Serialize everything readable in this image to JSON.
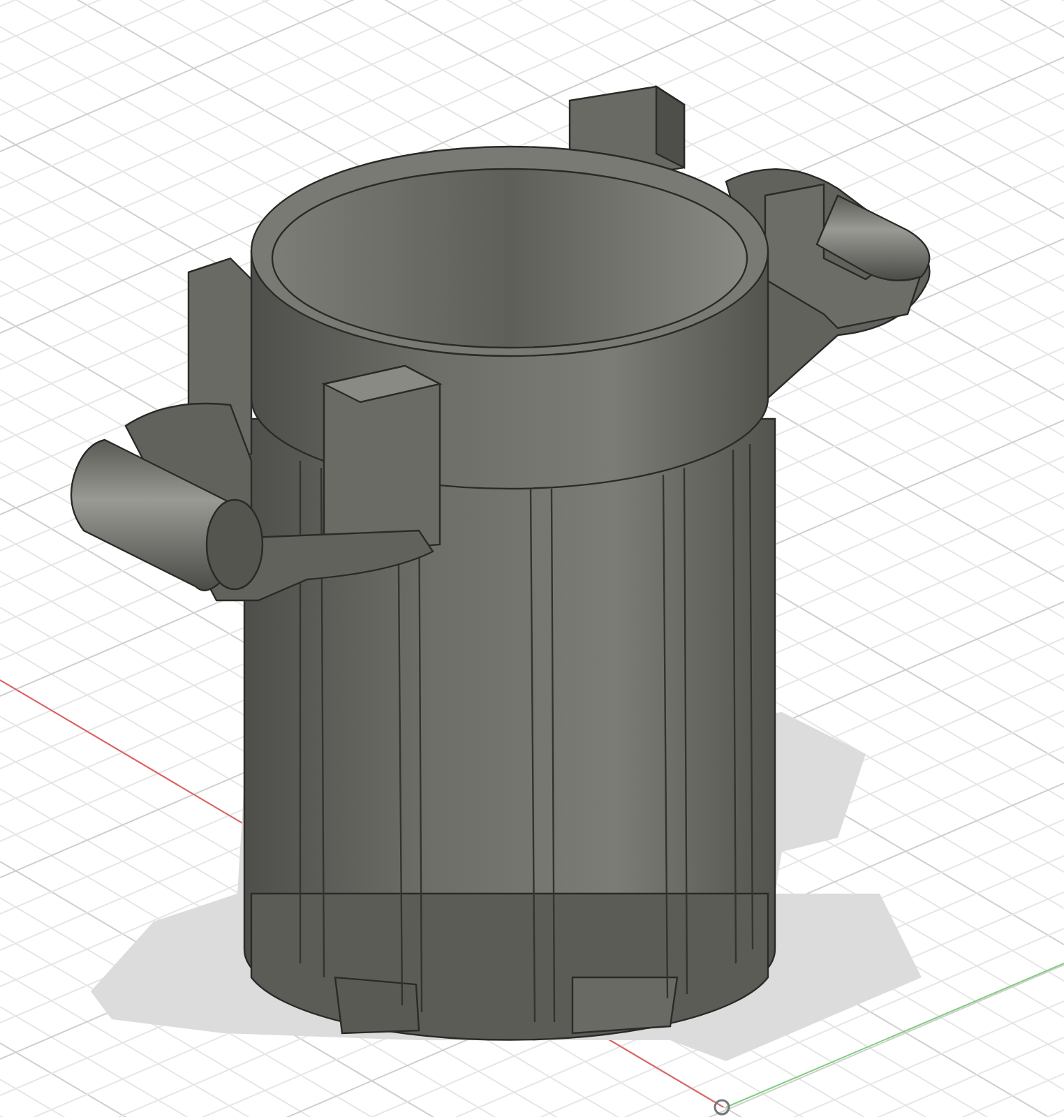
{
  "viewport": {
    "grid_visible": true,
    "shadow_visible": true,
    "axes_visible": true
  }
}
